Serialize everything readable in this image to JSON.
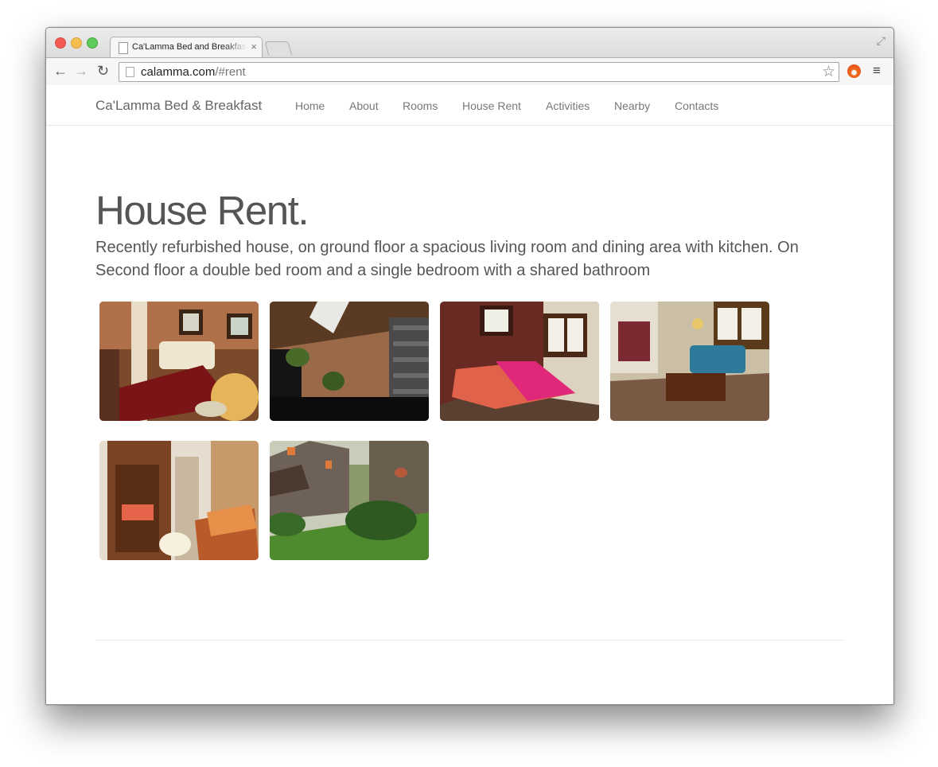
{
  "browser": {
    "tab_title": "Ca'Lamma Bed and Breakfast",
    "tab_close": "×",
    "url_host": "calamma.com",
    "url_path": "/#rent",
    "back_glyph": "←",
    "forward_glyph": "→",
    "reload_glyph": "↻",
    "star_glyph": "☆",
    "menu_glyph": "≡",
    "fullscreen_glyph": "⤢"
  },
  "site": {
    "brand": "Ca'Lamma Bed & Breakfast",
    "menu": [
      "Home",
      "About",
      "Rooms",
      "House Rent",
      "Activities",
      "Nearby",
      "Contacts"
    ]
  },
  "content": {
    "title": "House Rent.",
    "description": "Recently refurbished house, on ground floor a spacious living room and dining area with kitchen. On Second floor a double bed room and a single bedroom with a shared bathroom"
  },
  "gallery": [
    {
      "subject": "living-room"
    },
    {
      "subject": "staircase"
    },
    {
      "subject": "double-bedroom"
    },
    {
      "subject": "dining-room"
    },
    {
      "subject": "single-bedroom"
    },
    {
      "subject": "house-exterior"
    }
  ]
}
